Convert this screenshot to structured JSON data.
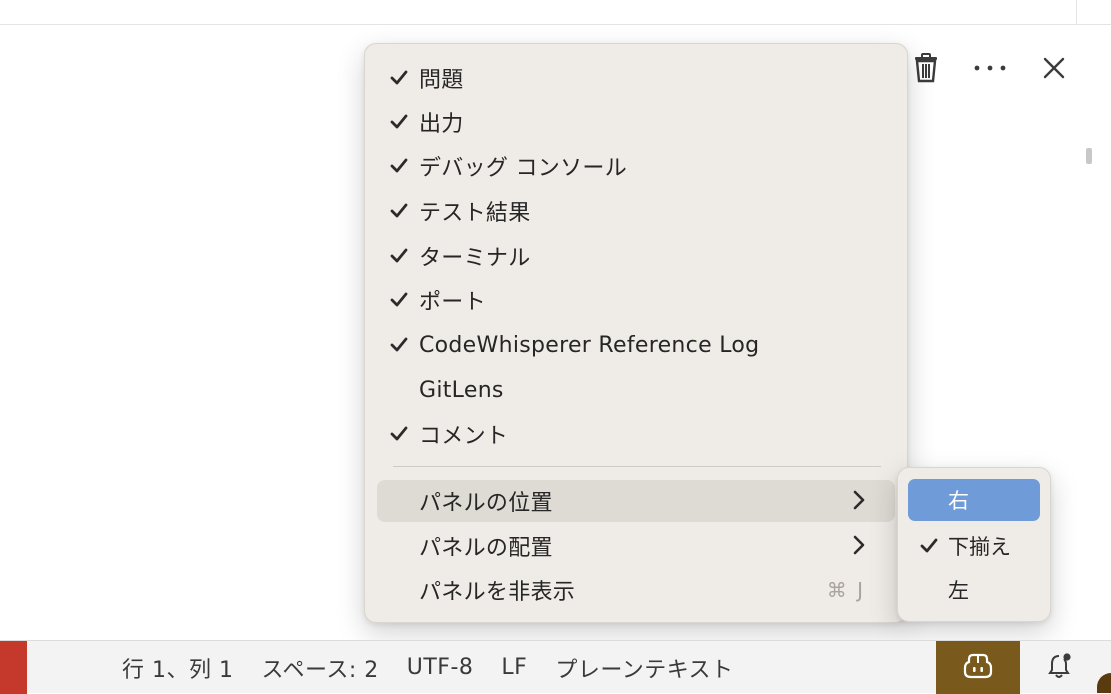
{
  "panel_actions": {
    "icons": [
      "trash-icon",
      "ellipsis-icon",
      "close-icon"
    ]
  },
  "context_menu": {
    "items": [
      {
        "label": "問題",
        "checked": true
      },
      {
        "label": "出力",
        "checked": true
      },
      {
        "label": "デバッグ コンソール",
        "checked": true
      },
      {
        "label": "テスト結果",
        "checked": true
      },
      {
        "label": "ターミナル",
        "checked": true
      },
      {
        "label": "ポート",
        "checked": true
      },
      {
        "label": "CodeWhisperer Reference Log",
        "checked": true
      },
      {
        "label": "GitLens",
        "checked": false
      },
      {
        "label": "コメント",
        "checked": true
      }
    ],
    "panel_position": {
      "label": "パネルの位置"
    },
    "panel_alignment": {
      "label": "パネルの配置"
    },
    "hide_panel": {
      "label": "パネルを非表示",
      "shortcut": "⌘ J"
    }
  },
  "position_submenu": {
    "items": [
      {
        "label": "右",
        "checked": false,
        "highlighted": true
      },
      {
        "label": "下揃え",
        "checked": true,
        "highlighted": false
      },
      {
        "label": "左",
        "checked": false,
        "highlighted": false
      }
    ]
  },
  "statusbar": {
    "cursor_position": "行 1、列 1",
    "indentation": "スペース: 2",
    "encoding": "UTF-8",
    "line_ending": "LF",
    "language_mode": "プレーンテキスト"
  },
  "colors": {
    "menu_bg": "#efebe6",
    "highlight_bg": "#dedad4",
    "selected_bg": "#6f9bd9",
    "remote_bg": "#c5382c",
    "copilot_bg": "#7a5a1c"
  }
}
